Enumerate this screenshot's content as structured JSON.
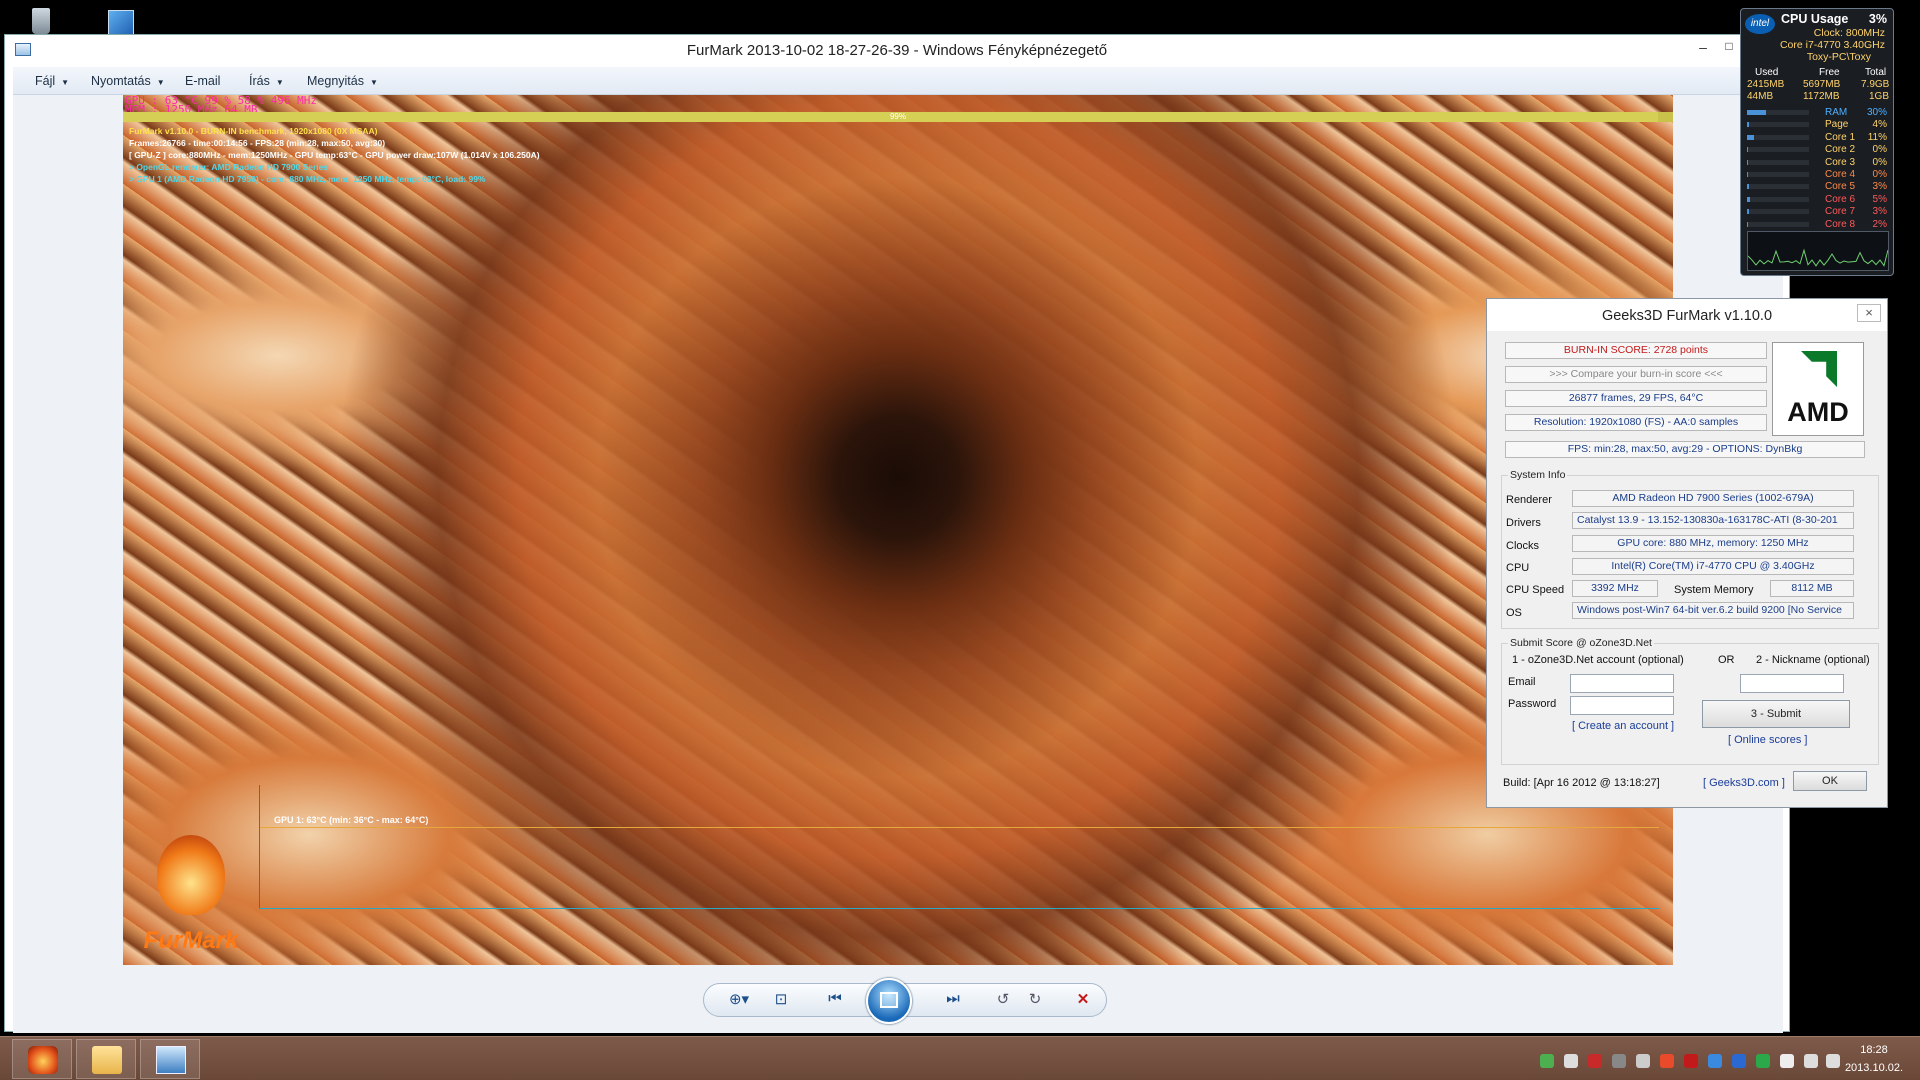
{
  "window": {
    "title": "FurMark 2013-10-02 18-27-26-39 - Windows Fényképnézegető",
    "minimize": "–",
    "maximize": "□"
  },
  "menu": [
    {
      "label": "Fájl"
    },
    {
      "label": "Nyomtatás"
    },
    {
      "label": "E-mail"
    },
    {
      "label": "Írás"
    },
    {
      "label": "Megnyitás"
    }
  ],
  "osd": {
    "gpu_line": "GPU  :  63 °C   99 %   58 %   496 MHz",
    "mem_line": "MEM  :  1250 MHz   64 MB",
    "ogl_line": "OGL  :  29.2 FPS",
    "progress_label": "99%",
    "progress": 0.99,
    "lines": [
      "FurMark v1.10.0 - BURN-IN benchmark, 1920x1080 (0X MSAA)",
      "Frames:26766 - time:00:14:56 - FPS:28 (min:28, max:50, avg:30)",
      "[ GPU-Z ] core:880MHz - mem:1250MHz - GPU temp:63°C - GPU power draw:107W (1.014V x 106.250A)",
      "> OpenGL renderer: AMD Radeon HD 7900 Series",
      "> GPU 1 (AMD Radeon HD 7950) - core: 880 MHz, mem: 1250 MHz, temp: 63°C, load: 99%"
    ],
    "graph_label": "GPU 1: 63°C (min: 36°C - max: 64°C)",
    "logo_text": "FurMark",
    "colors": {
      "osd_gpu": "#ff2aa8",
      "line1": "#ffe14a",
      "line2": "#ffffff",
      "line3": "#ffffff",
      "line4": "#4fd8e8",
      "line5": "#4fd8e8"
    }
  },
  "cpu_gadget": {
    "brand": "intel",
    "title": "CPU Usage",
    "total": "3%",
    "clock": "Clock:  800MHz",
    "model": "Core i7-4770 3.40GHz",
    "host": "Toxy-PC\\Toxy",
    "headers": [
      "Used",
      "Free",
      "Total"
    ],
    "ram_rows": [
      [
        "2415MB",
        "5697MB",
        "7.9GB"
      ],
      [
        "44MB",
        "1172MB",
        "1GB"
      ]
    ],
    "cores": [
      {
        "name": "RAM",
        "pct": "30%",
        "level": 0.3,
        "color": "#4fb0ff"
      },
      {
        "name": "Page",
        "pct": "4%",
        "level": 0.04,
        "color": "#ffd36b"
      },
      {
        "name": "Core 1",
        "pct": "11%",
        "level": 0.11,
        "color": "#ffd36b"
      },
      {
        "name": "Core 2",
        "pct": "0%",
        "level": 0.0,
        "color": "#ffd36b"
      },
      {
        "name": "Core 3",
        "pct": "0%",
        "level": 0.0,
        "color": "#ffd36b"
      },
      {
        "name": "Core 4",
        "pct": "0%",
        "level": 0.0,
        "color": "#ff8a4a"
      },
      {
        "name": "Core 5",
        "pct": "3%",
        "level": 0.03,
        "color": "#ff8a4a"
      },
      {
        "name": "Core 6",
        "pct": "5%",
        "level": 0.05,
        "color": "#ff5a5a"
      },
      {
        "name": "Core 7",
        "pct": "3%",
        "level": 0.03,
        "color": "#ff5a5a"
      },
      {
        "name": "Core 8",
        "pct": "2%",
        "level": 0.02,
        "color": "#ff5a5a"
      }
    ]
  },
  "furmark_dialog": {
    "title": "Geeks3D FurMark v1.10.0",
    "close": "×",
    "burn_in_score": "BURN-IN SCORE: 2728 points",
    "compare": ">>> Compare your burn-in score <<<",
    "frames": "26877 frames, 29 FPS, 64°C",
    "resolution": "Resolution: 1920x1080 (FS) - AA:0 samples",
    "fps": "FPS: min:28, max:50, avg:29 - OPTIONS: DynBkg",
    "amd_logo": "AMD",
    "system_info": {
      "legend": "System Info",
      "renderer_label": "Renderer",
      "renderer": "AMD Radeon HD 7900 Series (1002-679A)",
      "drivers_label": "Drivers",
      "drivers": "Catalyst 13.9 - 13.152-130830a-163178C-ATI (8-30-201",
      "clocks_label": "Clocks",
      "clocks": "GPU core: 880 MHz, memory: 1250 MHz",
      "cpu_label": "CPU",
      "cpu": "Intel(R) Core(TM) i7-4770 CPU @ 3.40GHz",
      "cpu_speed_label": "CPU Speed",
      "cpu_speed": "3392 MHz",
      "sys_mem_label": "System Memory",
      "sys_mem": "8112 MB",
      "os_label": "OS",
      "os": "Windows post-Win7 64-bit ver.6.2 build 9200 [No Service"
    },
    "submit": {
      "legend": "Submit Score @ oZone3D.Net",
      "account_label": "1 - oZone3D.Net account (optional)",
      "or_label": "OR",
      "nickname_label": "2 - Nickname (optional)",
      "email_label": "Email",
      "password_label": "Password",
      "create_account": "[ Create an account ]",
      "submit_button": "3 - Submit",
      "online_scores": "[ Online scores ]"
    },
    "build": "Build: [Apr 16 2012 @ 13:18:27]",
    "geeks_link": "[ Geeks3D.com ]",
    "ok_button": "OK"
  },
  "toolbar": {
    "zoom_icon": "zoom-icon",
    "fit_icon": "fit-icon",
    "prev_icon": "previous-icon",
    "slideshow_icon": "slideshow-icon",
    "next_icon": "next-icon",
    "rotate_ccw_icon": "rotate-left-icon",
    "rotate_cw_icon": "rotate-right-icon",
    "delete_icon": "delete-icon"
  },
  "taskbar": {
    "apps": [
      "furmark",
      "file-explorer",
      "photo-viewer"
    ],
    "time": "18:28",
    "date": "2013.10.02."
  }
}
